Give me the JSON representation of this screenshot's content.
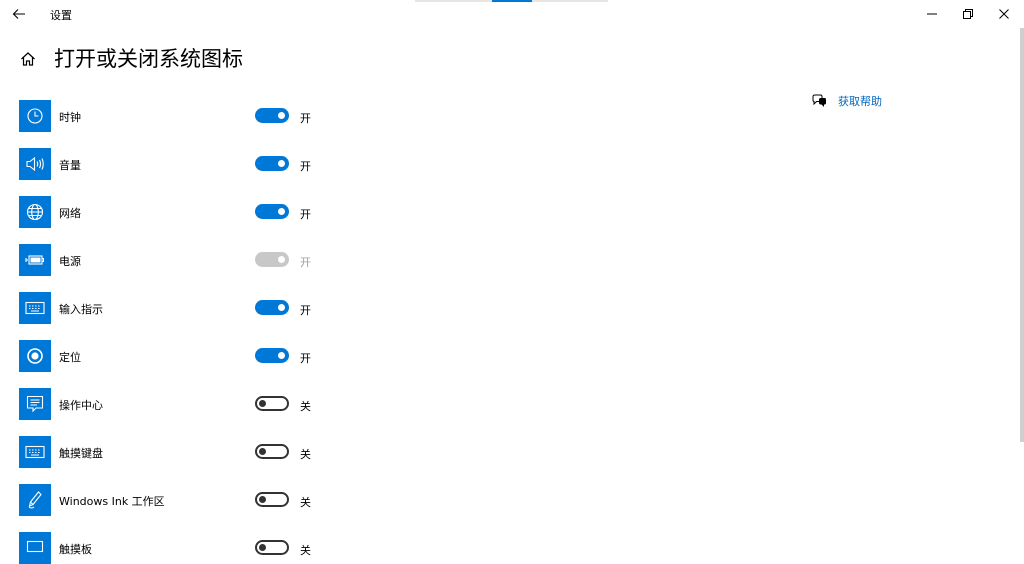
{
  "window": {
    "title": "设置",
    "controls": {
      "minimize": "—",
      "maximize": "❐",
      "close": "✕"
    }
  },
  "header": {
    "title": "打开或关闭系统图标"
  },
  "help": {
    "label": "获取帮助"
  },
  "items": [
    {
      "label": "时钟",
      "state": "开",
      "status": "on",
      "icon": "clock-icon"
    },
    {
      "label": "音量",
      "state": "开",
      "status": "on",
      "icon": "volume-icon"
    },
    {
      "label": "网络",
      "state": "开",
      "status": "on",
      "icon": "globe-icon"
    },
    {
      "label": "电源",
      "state": "开",
      "status": "disabled",
      "icon": "battery-icon"
    },
    {
      "label": "输入指示",
      "state": "开",
      "status": "on",
      "icon": "keyboard-icon"
    },
    {
      "label": "定位",
      "state": "开",
      "status": "on",
      "icon": "location-icon"
    },
    {
      "label": "操作中心",
      "state": "关",
      "status": "off",
      "icon": "action-center-icon"
    },
    {
      "label": "触摸键盘",
      "state": "关",
      "status": "off",
      "icon": "touch-keyboard-icon"
    },
    {
      "label": "Windows Ink 工作区",
      "state": "关",
      "status": "off",
      "icon": "pen-icon"
    },
    {
      "label": "触摸板",
      "state": "关",
      "status": "off",
      "icon": "touchpad-icon"
    }
  ],
  "colors": {
    "accent": "#0078d7",
    "link": "#0067c0",
    "toggle_off_border": "#333333",
    "toggle_disabled": "#c8c8c8"
  }
}
